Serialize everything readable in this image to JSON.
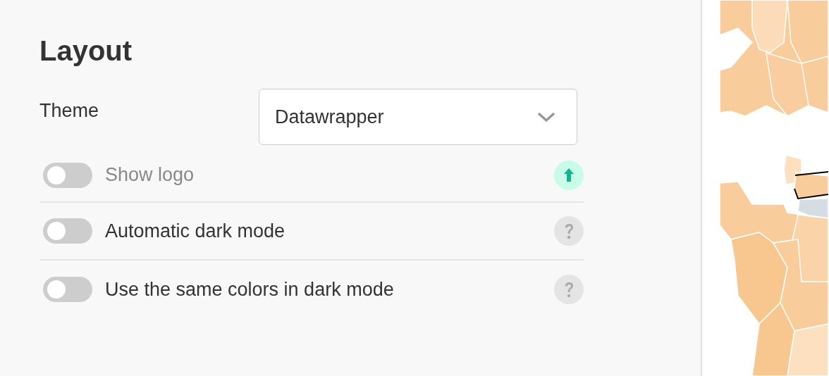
{
  "section": {
    "title": "Layout"
  },
  "theme": {
    "label": "Theme",
    "value": "Datawrapper"
  },
  "options": [
    {
      "label": "Show logo",
      "on": false,
      "disabled": true,
      "kind": "upgrade"
    },
    {
      "label": "Automatic dark mode",
      "on": false,
      "disabled": false,
      "kind": "help"
    },
    {
      "label": "Use the same colors in dark mode",
      "on": false,
      "disabled": false,
      "kind": "help"
    }
  ]
}
